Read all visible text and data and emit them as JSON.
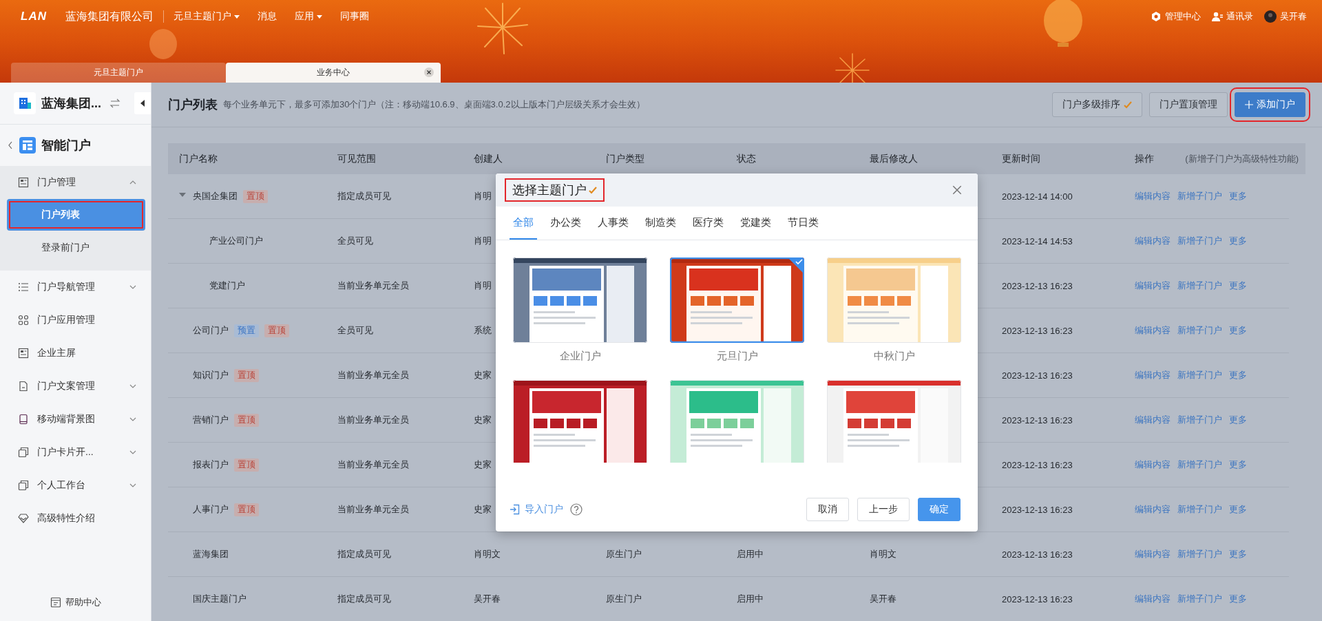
{
  "header": {
    "logo": "LAN",
    "company": "蓝海集团有限公司",
    "nav": [
      {
        "label": "元旦主题门户",
        "dropdown": true
      },
      {
        "label": "消息",
        "dropdown": false
      },
      {
        "label": "应用",
        "dropdown": true
      },
      {
        "label": "同事圈",
        "dropdown": false
      }
    ],
    "actions": [
      {
        "label": "管理中心",
        "kind": "settings"
      },
      {
        "label": "通讯录",
        "kind": "contacts"
      },
      {
        "label": "吴开春",
        "kind": "avatar"
      }
    ]
  },
  "tabs": [
    {
      "label": "元旦主题门户",
      "selected": false,
      "closable": false
    },
    {
      "label": "业务中心",
      "selected": true,
      "closable": true
    }
  ],
  "sidebar": {
    "org": "蓝海集团...",
    "app": "智能门户",
    "items": [
      {
        "label": "门户管理",
        "kind": "card",
        "expanded": true,
        "children": [
          {
            "label": "门户列表",
            "selected": true,
            "highlighted": true
          },
          {
            "label": "登录前门户",
            "selected": false,
            "highlighted": false
          }
        ]
      },
      {
        "label": "门户导航管理",
        "kind": "list",
        "expanded": false
      },
      {
        "label": "门户应用管理",
        "kind": "grid"
      },
      {
        "label": "企业主屏",
        "kind": "card"
      },
      {
        "label": "门户文案管理",
        "kind": "doc",
        "expanded": false
      },
      {
        "label": "移动端背景图",
        "kind": "phone",
        "expanded": false
      },
      {
        "label": "门户卡片开...",
        "kind": "copy",
        "expanded": false
      },
      {
        "label": "个人工作台",
        "kind": "copy",
        "expanded": false
      },
      {
        "label": "高级特性介绍",
        "kind": "diamond"
      }
    ],
    "help": "帮助中心"
  },
  "page": {
    "title": "门户列表",
    "note": "每个业务单元下，最多可添加30个门户（注：移动端10.6.9、桌面端3.0.2以上版本门户层级关系才会生效）",
    "buttons": [
      {
        "label": "门户多级排序",
        "kind": "default",
        "tick": true,
        "highlighted": false
      },
      {
        "label": "门户置顶管理",
        "kind": "default",
        "tick": false,
        "highlighted": false
      },
      {
        "label": "添加门户",
        "kind": "primary",
        "tick": false,
        "highlighted": true
      }
    ]
  },
  "table": {
    "columns": [
      "门户名称",
      "可见范围",
      "创建人",
      "门户类型",
      "状态",
      "最后修改人",
      "更新时间",
      "操作"
    ],
    "action_note": "(新增子门户为高级特性功能)",
    "rows": [
      {
        "name": "央国企集团",
        "tags": [
          {
            "label": "置顶",
            "kind": "pinned"
          }
        ],
        "scope": "指定成员可见",
        "creator": "肖明",
        "updated": "2023-12-14 14:00",
        "actions": [
          "编辑内容",
          "新增子门户",
          "更多"
        ],
        "expanded": true,
        "children": [
          {
            "name": "产业公司门户",
            "scope": "全员可见",
            "creator": "肖明",
            "updated": "2023-12-14 14:53",
            "actions": [
              "编辑内容",
              "新增子门户",
              "更多"
            ]
          },
          {
            "name": "党建门户",
            "scope": "当前业务单元全员",
            "creator": "肖明",
            "updated": "2023-12-13 16:23",
            "actions": [
              "编辑内容",
              "新增子门户",
              "更多"
            ]
          }
        ]
      },
      {
        "name": "公司门户",
        "tags": [
          {
            "label": "预置",
            "kind": "preset"
          },
          {
            "label": "置顶",
            "kind": "pinned"
          }
        ],
        "scope": "全员可见",
        "creator": "系统",
        "updated": "2023-12-13 16:23",
        "actions": [
          "编辑内容",
          "新增子门户",
          "更多"
        ]
      },
      {
        "name": "知识门户",
        "tags": [
          {
            "label": "置顶",
            "kind": "pinned"
          }
        ],
        "scope": "当前业务单元全员",
        "creator": "史家",
        "updated": "2023-12-13 16:23",
        "actions": [
          "编辑内容",
          "新增子门户",
          "更多"
        ]
      },
      {
        "name": "营销门户",
        "tags": [
          {
            "label": "置顶",
            "kind": "pinned"
          }
        ],
        "scope": "当前业务单元全员",
        "creator": "史家",
        "updated": "2023-12-13 16:23",
        "actions": [
          "编辑内容",
          "新增子门户",
          "更多"
        ]
      },
      {
        "name": "报表门户",
        "tags": [
          {
            "label": "置顶",
            "kind": "pinned"
          }
        ],
        "scope": "当前业务单元全员",
        "creator": "史家",
        "updated": "2023-12-13 16:23",
        "actions": [
          "编辑内容",
          "新增子门户",
          "更多"
        ]
      },
      {
        "name": "人事门户",
        "tags": [
          {
            "label": "置顶",
            "kind": "pinned"
          }
        ],
        "scope": "当前业务单元全员",
        "creator": "史家",
        "updated": "2023-12-13 16:23",
        "actions": [
          "编辑内容",
          "新增子门户",
          "更多"
        ]
      },
      {
        "name": "蓝海集团",
        "scope": "指定成员可见",
        "creator": "肖明文",
        "type": "原生门户",
        "status": "启用中",
        "modifier": "肖明文",
        "updated": "2023-12-13 16:23",
        "actions": [
          "编辑内容",
          "新增子门户",
          "更多"
        ]
      },
      {
        "name": "国庆主题门户",
        "scope": "指定成员可见",
        "creator": "吴开春",
        "type": "原生门户",
        "status": "启用中",
        "modifier": "吴开春",
        "updated": "2023-12-13 16:23",
        "actions": [
          "编辑内容",
          "新增子门户",
          "更多"
        ]
      }
    ]
  },
  "modal": {
    "title": "选择主题门户",
    "title_tick": true,
    "highlighted": true,
    "tabs": [
      {
        "label": "全部",
        "selected": true
      },
      {
        "label": "办公类",
        "selected": false
      },
      {
        "label": "人事类",
        "selected": false
      },
      {
        "label": "制造类",
        "selected": false
      },
      {
        "label": "医疗类",
        "selected": false
      },
      {
        "label": "党建类",
        "selected": false
      },
      {
        "label": "节日类",
        "selected": false
      }
    ],
    "templates": [
      {
        "label": "企业门户",
        "kind": "corporate",
        "selected": false
      },
      {
        "label": "元旦门户",
        "kind": "newyear",
        "selected": true
      },
      {
        "label": "中秋门户",
        "kind": "midautumn",
        "selected": false
      },
      {
        "kind": "national",
        "selected": false
      },
      {
        "kind": "dragonboat",
        "selected": false
      },
      {
        "kind": "party",
        "selected": false
      }
    ],
    "import_link": "导入门户",
    "buttons": [
      {
        "label": "取消",
        "kind": "default"
      },
      {
        "label": "上一步",
        "kind": "default"
      },
      {
        "label": "确定",
        "kind": "primary"
      }
    ]
  }
}
